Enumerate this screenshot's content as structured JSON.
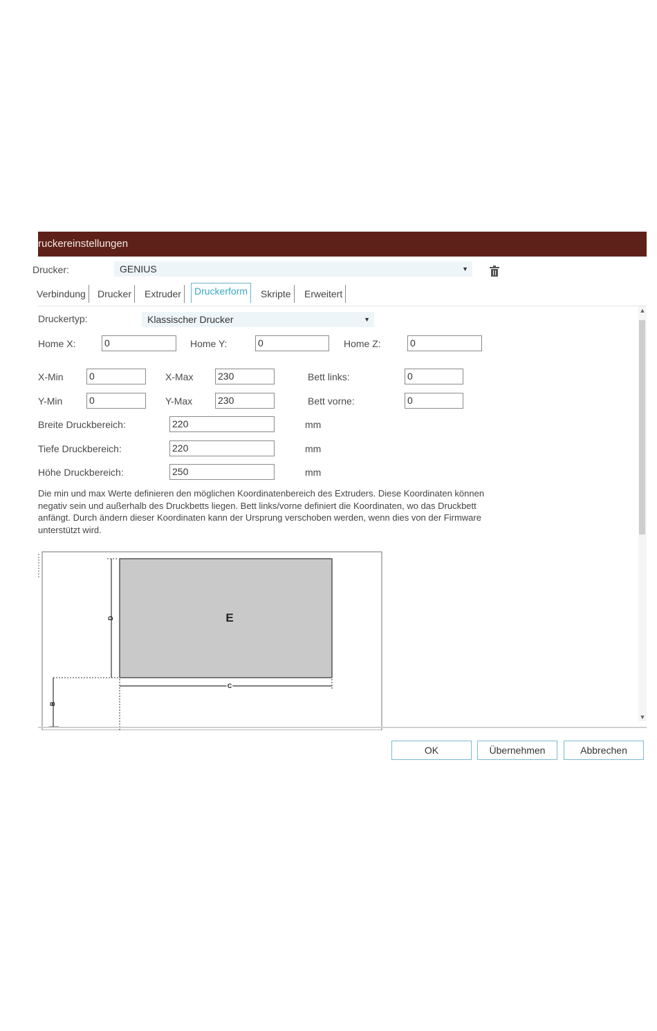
{
  "dialog": {
    "title": "ruckereinstellungen",
    "printer_label": "Drucker:",
    "printer_value": "GENIUS",
    "tabs": [
      "Verbindung",
      "Drucker",
      "Extruder",
      "Druckerform",
      "Skripte",
      "Erweitert"
    ],
    "active_tab": "Druckerform"
  },
  "form": {
    "printer_type_label": "Druckertyp:",
    "printer_type_value": "Klassischer Drucker",
    "home_x_label": "Home X:",
    "home_x": "0",
    "home_y_label": "Home Y:",
    "home_y": "0",
    "home_z_label": "Home Z:",
    "home_z": "0",
    "x_min_label": "X-Min",
    "x_min": "0",
    "x_max_label": "X-Max",
    "x_max": "230",
    "bed_left_label": "Bett links:",
    "bed_left": "0",
    "y_min_label": "Y-Min",
    "y_min": "0",
    "y_max_label": "Y-Max",
    "y_max": "230",
    "bed_front_label": "Bett vorne:",
    "bed_front": "0",
    "width_label": "Breite Druckbereich:",
    "width": "220",
    "depth_label": "Tiefe Druckbereich:",
    "depth": "220",
    "height_label": "Höhe Druckbereich:",
    "height": "250",
    "unit": "mm",
    "description": "Die min und max Werte definieren den möglichen Koordinatenbereich des Extruders. Diese Koordinaten können negativ sein und außerhalb des Druckbetts liegen. Bett links/vorne definiert die Koordinaten, wo das Druckbett anfängt. Durch ändern dieser Koordinaten kann der Ursprung verschoben werden, wenn dies von der Firmware unterstützt wird."
  },
  "diagram": {
    "label_e": "E",
    "label_d": "D",
    "label_c": "C",
    "label_b": "B"
  },
  "buttons": {
    "ok": "OK",
    "apply": "Übernehmen",
    "cancel": "Abbrechen"
  },
  "colors": {
    "titlebar": "#5e2119",
    "active_tab": "#3ba6c6",
    "bed_fill": "#c9c9c9"
  },
  "icons": {
    "delete": "trash-icon",
    "dropdown": "caret-down-icon"
  }
}
